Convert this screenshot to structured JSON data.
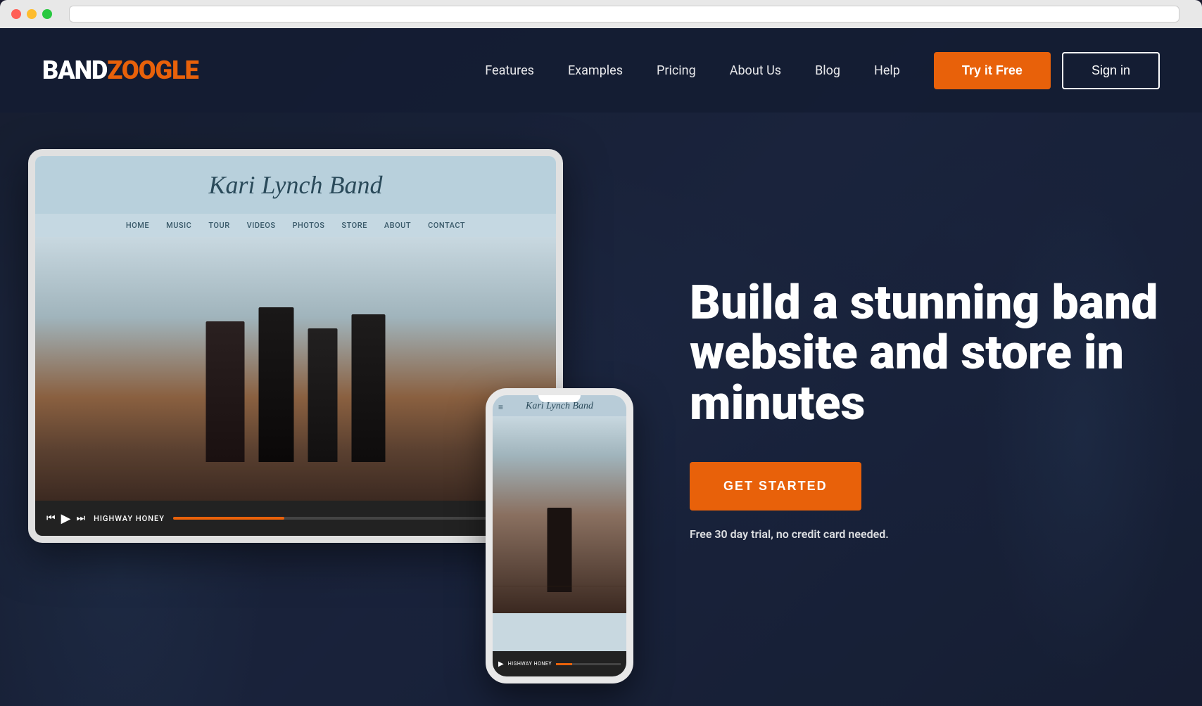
{
  "window": {
    "traffic_close": "close",
    "traffic_minimize": "minimize",
    "traffic_maximize": "maximize"
  },
  "navbar": {
    "logo_band": "BAND",
    "logo_zoogle": "ZOOGLE",
    "nav": {
      "features": "Features",
      "examples": "Examples",
      "pricing": "Pricing",
      "about_us": "About Us",
      "blog": "Blog",
      "help": "Help"
    },
    "try_free_label": "Try it Free",
    "sign_in_label": "Sign in"
  },
  "band_site": {
    "title": "Kari Lynch Band",
    "nav_items": [
      "HOME",
      "MUSIC",
      "TOUR",
      "VIDEOS",
      "PHOTOS",
      "STORE",
      "ABOUT",
      "CONTACT"
    ],
    "track_name": "HIGHWAY HONEY",
    "phone_track_name": "HIGHWAY HONEY"
  },
  "hero": {
    "headline": "Build a stunning band website and store in minutes",
    "cta_label": "GET STARTED",
    "trial_text": "Free 30 day trial, no credit card needed."
  }
}
